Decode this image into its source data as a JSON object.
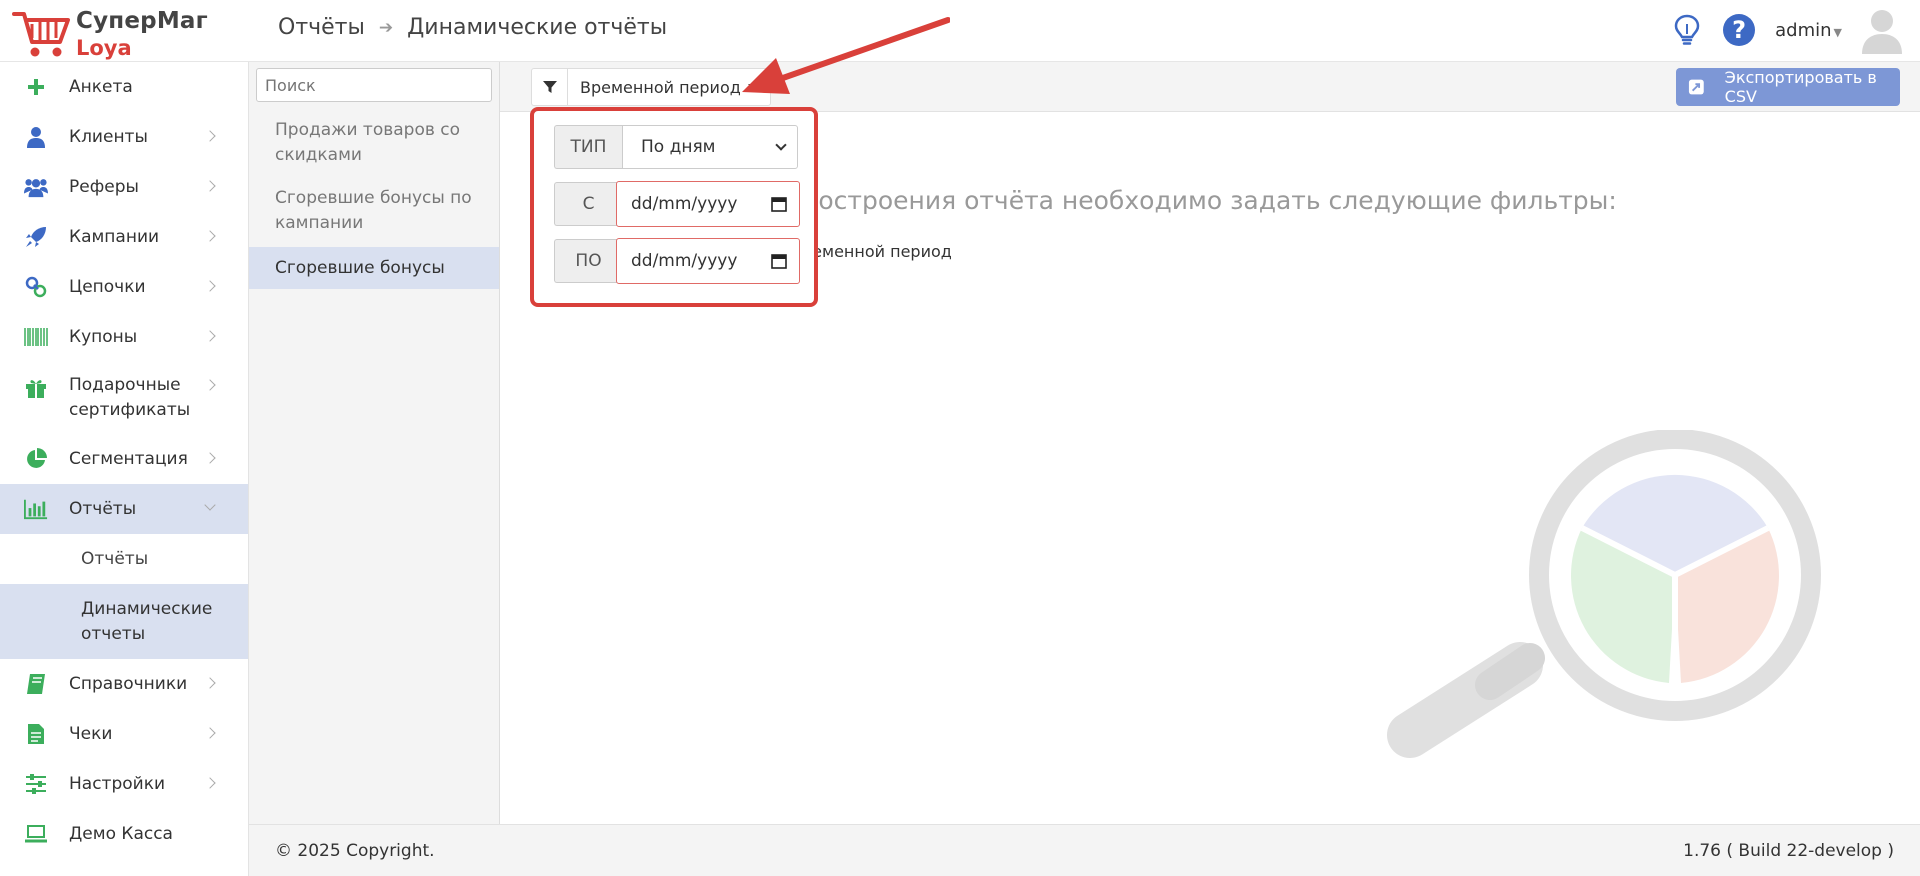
{
  "app": {
    "brand_line1": "СуперМаг",
    "brand_line2": "Loya"
  },
  "breadcrumb": {
    "parent": "Отчёты",
    "current": "Динамические отчёты"
  },
  "user": {
    "name": "admin"
  },
  "sidebar": {
    "items": [
      {
        "label": "Анкета",
        "icon": "plus-icon"
      },
      {
        "label": "Клиенты",
        "icon": "user-icon"
      },
      {
        "label": "Реферы",
        "icon": "users-icon"
      },
      {
        "label": "Кампании",
        "icon": "rocket-icon"
      },
      {
        "label": "Цепочки",
        "icon": "link-icon"
      },
      {
        "label": "Купоны",
        "icon": "barcode-icon"
      },
      {
        "label": "Подарочные сертификаты",
        "icon": "gift-icon"
      },
      {
        "label": "Сегментация",
        "icon": "pie-chart-icon"
      },
      {
        "label": "Отчёты",
        "icon": "bar-chart-icon"
      },
      {
        "label": "Справочники",
        "icon": "book-icon"
      },
      {
        "label": "Чеки",
        "icon": "receipt-icon"
      },
      {
        "label": "Настройки",
        "icon": "sliders-icon"
      },
      {
        "label": "Демо Касса",
        "icon": "laptop-icon"
      }
    ],
    "reports_sub": [
      {
        "label": "Отчёты"
      },
      {
        "label": "Динамические отчеты"
      }
    ]
  },
  "reports_list": {
    "search_placeholder": "Поиск",
    "items": [
      {
        "label": "Продажи товаров со скидками"
      },
      {
        "label": "Сгоревшие бонусы по кампании"
      },
      {
        "label": "Сгоревшие бонусы"
      }
    ]
  },
  "toolbar": {
    "period_label": "Временной период",
    "export_label": "Экспортировать в CSV"
  },
  "main": {
    "message": "построения отчёта необходимо задать следующие фильтры:",
    "message_sub": "ременной период"
  },
  "popover": {
    "type_label": "ТИП",
    "type_value": "По дням",
    "from_label": "С",
    "from_value": "dd/mm/yyyy",
    "to_label": "ПО",
    "to_value": "dd/mm/yyyy"
  },
  "footer": {
    "copyright": "© 2025 Copyright.",
    "build": "1.76 ( Build 22-develop )"
  },
  "colors": {
    "accent": "#3d69c4",
    "highlight": "#d9e0f0",
    "annotation": "#d9403a",
    "export_button": "#7d97d6",
    "icon_green": "#3cae5c"
  }
}
